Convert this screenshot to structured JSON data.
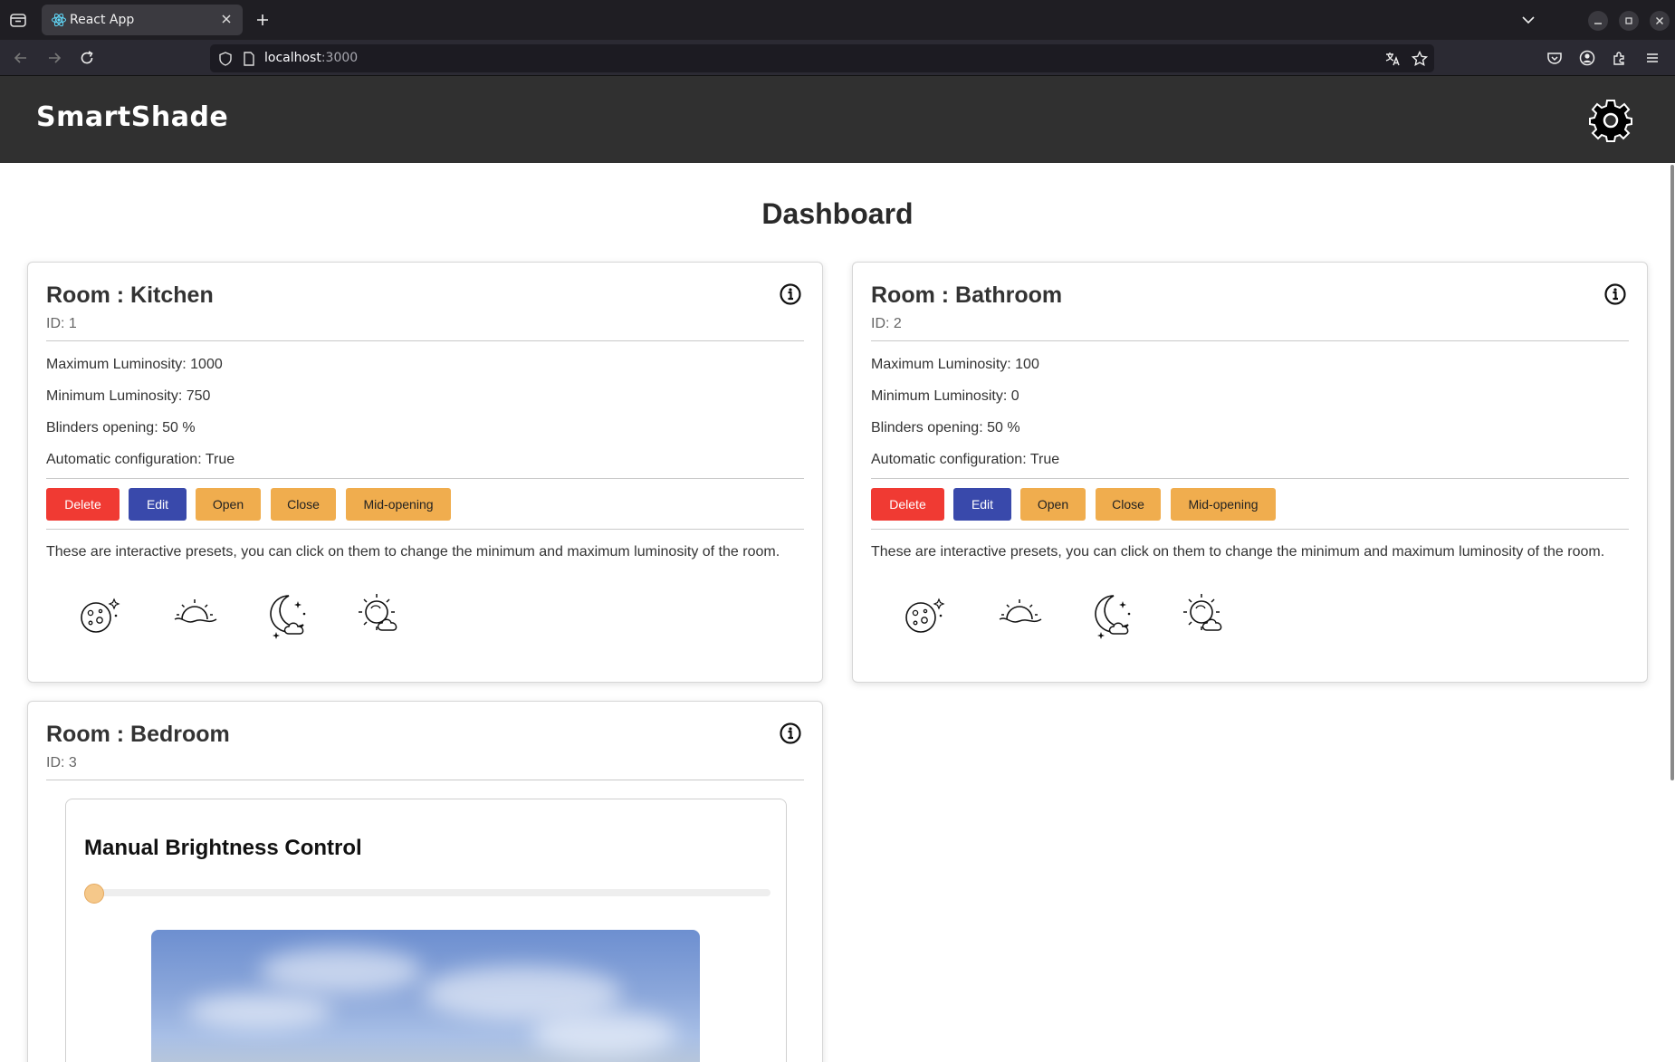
{
  "browser": {
    "tab_title": "React App",
    "url_host": "localhost",
    "url_port": ":3000"
  },
  "app": {
    "brand": "SmartShade",
    "page_title": "Dashboard"
  },
  "labels": {
    "room_prefix": "Room : ",
    "id_prefix": "ID: ",
    "max_lum": "Maximum Luminosity: ",
    "min_lum": "Minimum Luminosity: ",
    "opening": "Blinders opening: ",
    "auto": "Automatic configuration: ",
    "percent_suffix": " %"
  },
  "buttons": {
    "delete": "Delete",
    "edit": "Edit",
    "open": "Open",
    "close": "Close",
    "mid": "Mid-opening"
  },
  "preset_text": "These are interactive presets, you can click on them to change the minimum and maximum luminosity of the room.",
  "presets": [
    "night-moon-icon",
    "sunrise-icon",
    "crescent-moon-cloud-icon",
    "partly-cloudy-sun-icon"
  ],
  "rooms": [
    {
      "name": "Kitchen",
      "id": "1",
      "max": "1000",
      "min": "750",
      "opening": "50",
      "auto": "True"
    },
    {
      "name": "Bathroom",
      "id": "2",
      "max": "100",
      "min": "0",
      "opening": "50",
      "auto": "True"
    },
    {
      "name": "Bedroom",
      "id": "3"
    }
  ],
  "manual_control": {
    "title": "Manual Brightness Control",
    "slider_value_fraction": 0
  },
  "colors": {
    "header_bg": "#303030",
    "delete": "#f03a33",
    "edit": "#3949ab",
    "action": "#f0ad4e"
  }
}
